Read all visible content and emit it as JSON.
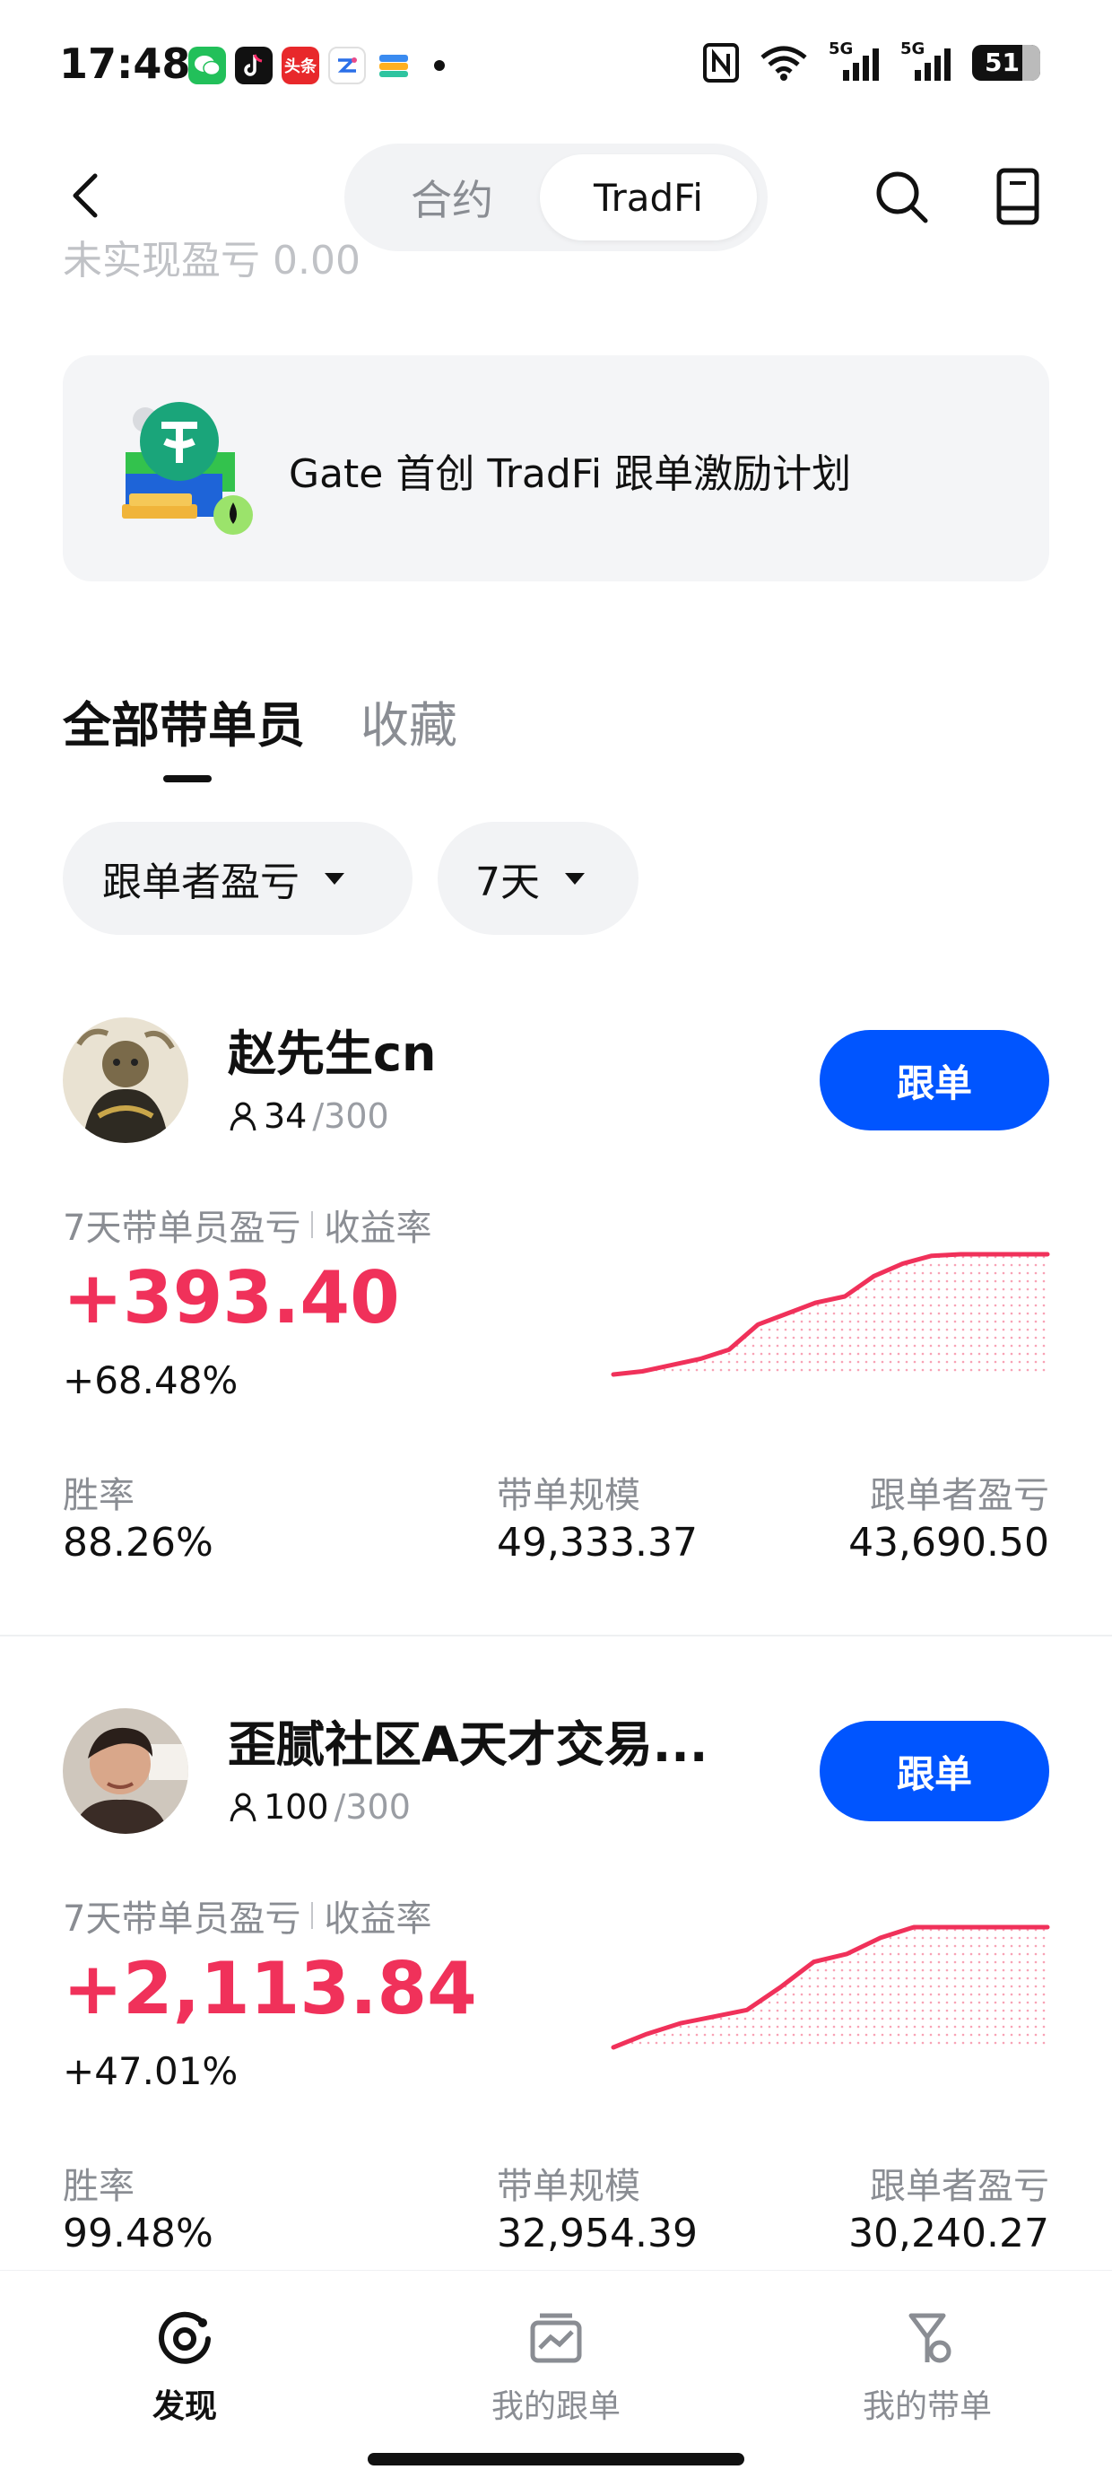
{
  "status_bar": {
    "time": "17:48",
    "app_badge_text": "头条",
    "network_1": "5G",
    "network_2": "5G",
    "battery_level": "51",
    "icons": [
      "wechat-icon",
      "tiktok-icon",
      "toutiao-icon",
      "app-icon",
      "wallet-icon",
      "nfc-icon",
      "wifi-icon",
      "signal-icon",
      "signal-icon",
      "battery-icon"
    ]
  },
  "nav": {
    "tab_contract": "合约",
    "tab_tradfi": "TradFi",
    "active_tab": "TradFi"
  },
  "peek_text": "未实现盈亏 0.00",
  "banner": {
    "text": "Gate 首创 TradFi 跟单激励计划"
  },
  "tabs": {
    "all": "全部带单员",
    "favorites": "收藏",
    "active": "全部带单员"
  },
  "filters": {
    "sort": "跟单者盈亏",
    "period": "7天"
  },
  "colors": {
    "accent": "#0055ff",
    "profit": "#f0315a"
  },
  "traders": [
    {
      "name": "赵先生cn",
      "followers": "34",
      "capacity": "/300",
      "follow_label": "跟单",
      "pnl_label": "7天带单员盈亏",
      "rate_label": "收益率",
      "pnl": "+393.40",
      "rate": "+68.48%",
      "win_rate_label": "胜率",
      "win_rate": "88.26%",
      "aum_label": "带单规模",
      "aum": "49,333.37",
      "follower_pnl_label": "跟单者盈亏",
      "follower_pnl": "43,690.50",
      "trend": [
        1,
        1.2,
        1.6,
        2.0,
        2.6,
        4.2,
        4.9,
        5.6,
        6.0,
        7.3,
        8.1,
        8.6,
        8.7,
        8.7,
        8.7,
        8.7
      ]
    },
    {
      "name": "歪腻社区A天才交易...",
      "followers": "100",
      "capacity": "/300",
      "follow_label": "跟单",
      "pnl_label": "7天带单员盈亏",
      "rate_label": "收益率",
      "pnl": "+2,113.84",
      "rate": "+47.01%",
      "win_rate_label": "胜率",
      "win_rate": "99.48%",
      "aum_label": "带单规模",
      "aum": "32,954.39",
      "follower_pnl_label": "跟单者盈亏",
      "follower_pnl": "30,240.27",
      "trend": [
        1,
        2.0,
        2.8,
        3.3,
        3.8,
        5.5,
        7.4,
        8.0,
        9.2,
        10.0,
        10.0,
        10.0,
        10.0,
        10.0
      ]
    }
  ],
  "bottom_nav": {
    "discover": "发现",
    "my_copy": "我的跟单",
    "my_lead": "我的带单",
    "active": "发现"
  }
}
